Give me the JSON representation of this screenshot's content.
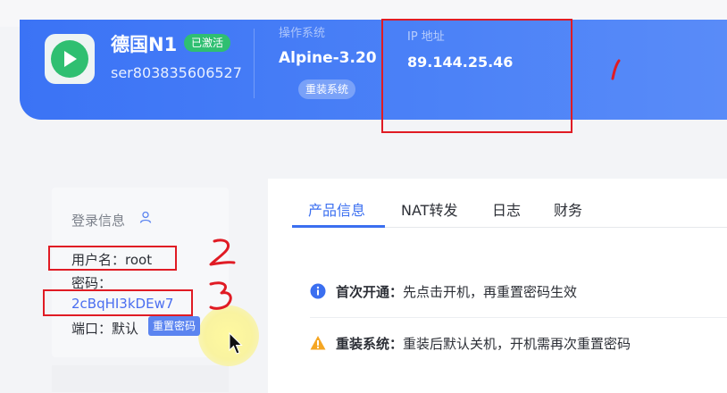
{
  "server": {
    "name": "德国N1",
    "status_badge": "已激活",
    "id": "ser803835606527",
    "os_label": "操作系统",
    "os_value": "Alpine-3.20",
    "reinstall_label": "重装系统",
    "ip_label": "IP 地址",
    "ip_value": "89.144.25.46"
  },
  "login": {
    "title": "登录信息",
    "username_line": "用户名：root",
    "password_label": "密码：",
    "password_value": "2cBqHI3kDEw7",
    "port_line": "端口：默认",
    "reset_password_label": "重置密码"
  },
  "tabs": [
    {
      "label": "产品信息",
      "active": true
    },
    {
      "label": "NAT转发",
      "active": false
    },
    {
      "label": "日志",
      "active": false
    },
    {
      "label": "财务",
      "active": false
    }
  ],
  "notices": [
    {
      "label": "首次开通：",
      "text": "先点击开机，再重置密码生效",
      "icon": "info-icon"
    },
    {
      "label": "重装系统：",
      "text": "重装后默认关机，开机需再次重置密码",
      "icon": "warning-icon"
    }
  ],
  "colors": {
    "hero": "#3b73f5",
    "accent": "#3b6ff0",
    "active": "#2fbf71",
    "annotation": "#e01b24",
    "warning": "#f5a623"
  }
}
